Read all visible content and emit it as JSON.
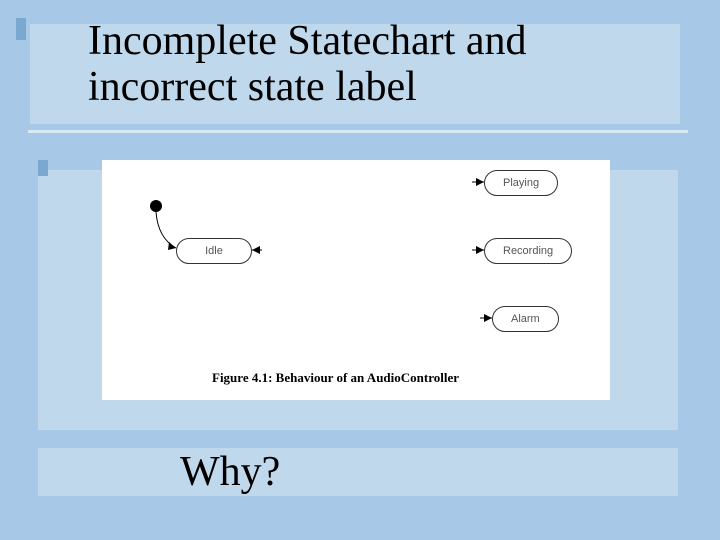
{
  "title": {
    "line1": "Incomplete Statechart and",
    "line2": "incorrect state label"
  },
  "diagram": {
    "states": {
      "idle": "Idle",
      "playing": "Playing",
      "recording": "Recording",
      "alarm": "Alarm"
    },
    "caption": "Figure 4.1: Behaviour of an AudioController"
  },
  "footer": {
    "why": "Why?"
  }
}
